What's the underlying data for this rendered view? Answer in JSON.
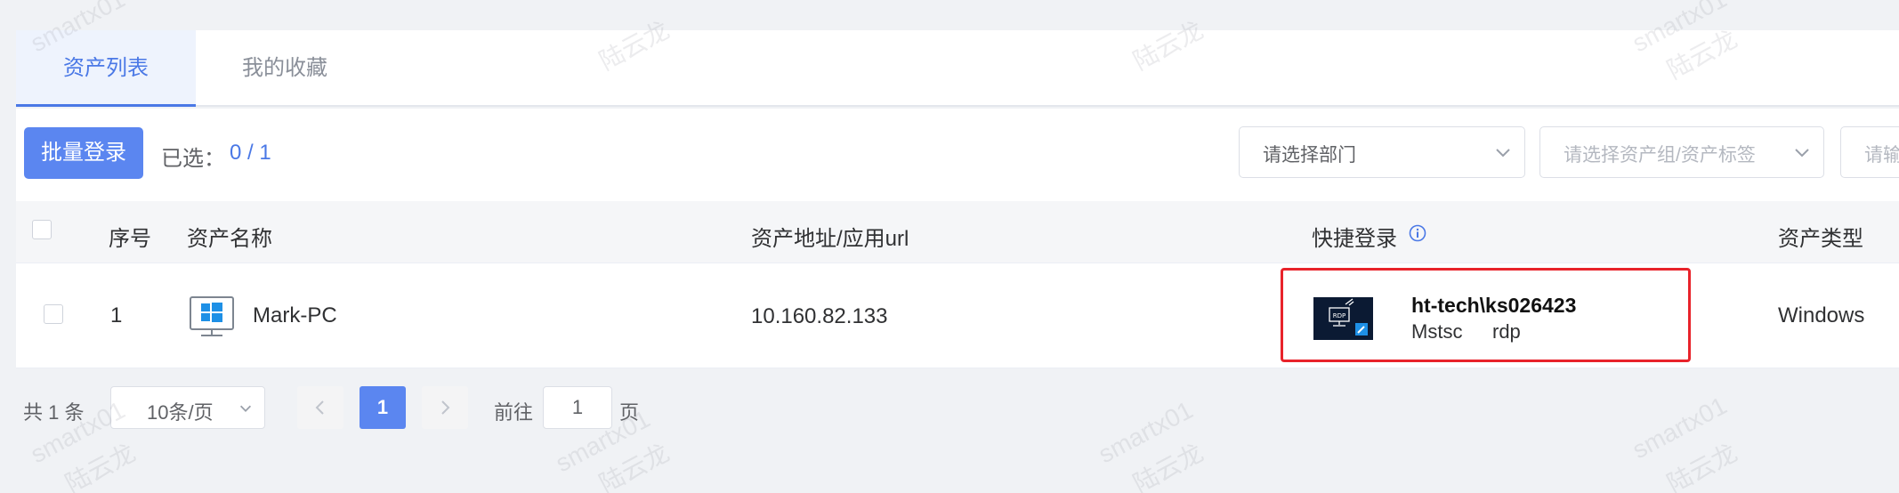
{
  "tabs": [
    {
      "label": "资产列表",
      "active": true
    },
    {
      "label": "我的收藏",
      "active": false
    }
  ],
  "toolbar": {
    "batch_login_label": "批量登录",
    "selected_label": "已选：",
    "selected_count": "0 / 1",
    "department_select_value": "请选择部门",
    "group_select_placeholder": "请选择资产组/资产标签",
    "third_input_placeholder": "请输"
  },
  "table": {
    "headers": {
      "index": "序号",
      "name": "资产名称",
      "address": "资产地址/应用url",
      "quick_login": "快捷登录",
      "type": "资产类型"
    },
    "rows": [
      {
        "index": "1",
        "name": "Mark-PC",
        "icon": "windows-pc-icon",
        "address": "10.160.82.133",
        "quick_login": {
          "account": "ht-tech\\ks026423",
          "tool": "Mstsc",
          "protocol": "rdp",
          "thumbnail_label": "RDP"
        },
        "type": "Windows"
      }
    ]
  },
  "pagination": {
    "total": "共 1 条",
    "page_size": "10条/页",
    "current_page": "1",
    "goto_label": "前往",
    "goto_value": "1",
    "page_label": "页"
  },
  "watermark": {
    "name": "smartx01",
    "user": "陆云龙"
  },
  "colors": {
    "primary": "#5b86f0",
    "link": "#4a78e6",
    "highlight_border": "#e8232a",
    "background": "#f0f2f5"
  }
}
